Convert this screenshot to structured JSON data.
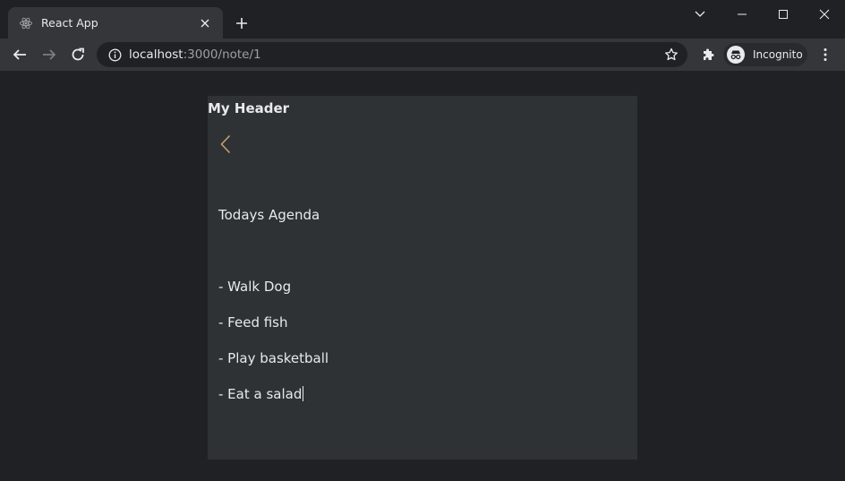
{
  "browser": {
    "tab": {
      "title": "React App",
      "favicon": "react-icon"
    },
    "address": {
      "host": "localhost",
      "path": ":3000/note/1"
    },
    "profile": {
      "label": "Incognito"
    }
  },
  "app": {
    "header": "My Header",
    "note": {
      "lines": [
        "Todays Agenda",
        "",
        "- Walk Dog",
        "- Feed fish",
        "- Play basketball",
        "- Eat a salad"
      ]
    }
  },
  "colors": {
    "accent_back_arrow": "#c9a27a",
    "card_background": "#2e3235",
    "page_background": "#202124"
  }
}
